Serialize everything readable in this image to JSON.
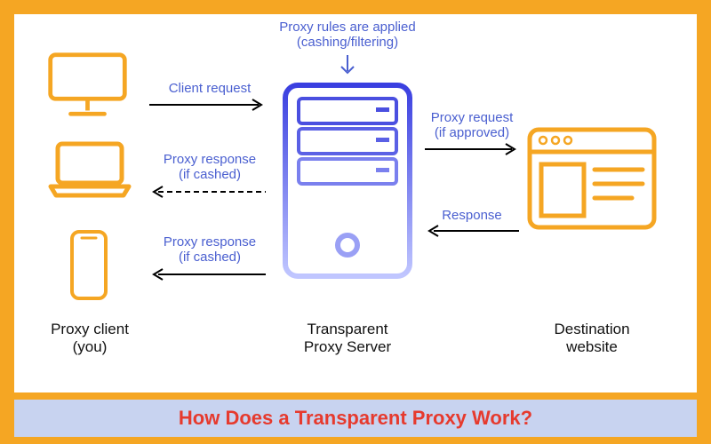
{
  "title": "How Does a Transparent Proxy Work?",
  "colors": {
    "accent_orange": "#f5a623",
    "accent_blue": "#4a5fd0",
    "title_bg": "#c8d3f0",
    "title_text": "#e63a2e",
    "server_dark": "#3a3fe0",
    "server_light": "#b8bfff"
  },
  "labels": {
    "rules": "Proxy rules are applied\n(cashing/filtering)",
    "client_request": "Client request",
    "proxy_request": "Proxy request\n(if approved)",
    "proxy_response": "Proxy response\n(if cashed)",
    "proxy_response2": "Proxy response\n(if cashed)",
    "response": "Response"
  },
  "bottom": {
    "client": "Proxy client\n(you)",
    "server": "Transparent\nProxy Server",
    "dest": "Destination\nwebsite"
  },
  "icons": {
    "monitor": "monitor-icon",
    "laptop": "laptop-icon",
    "phone": "phone-icon",
    "server": "server-icon",
    "browser": "browser-icon"
  }
}
